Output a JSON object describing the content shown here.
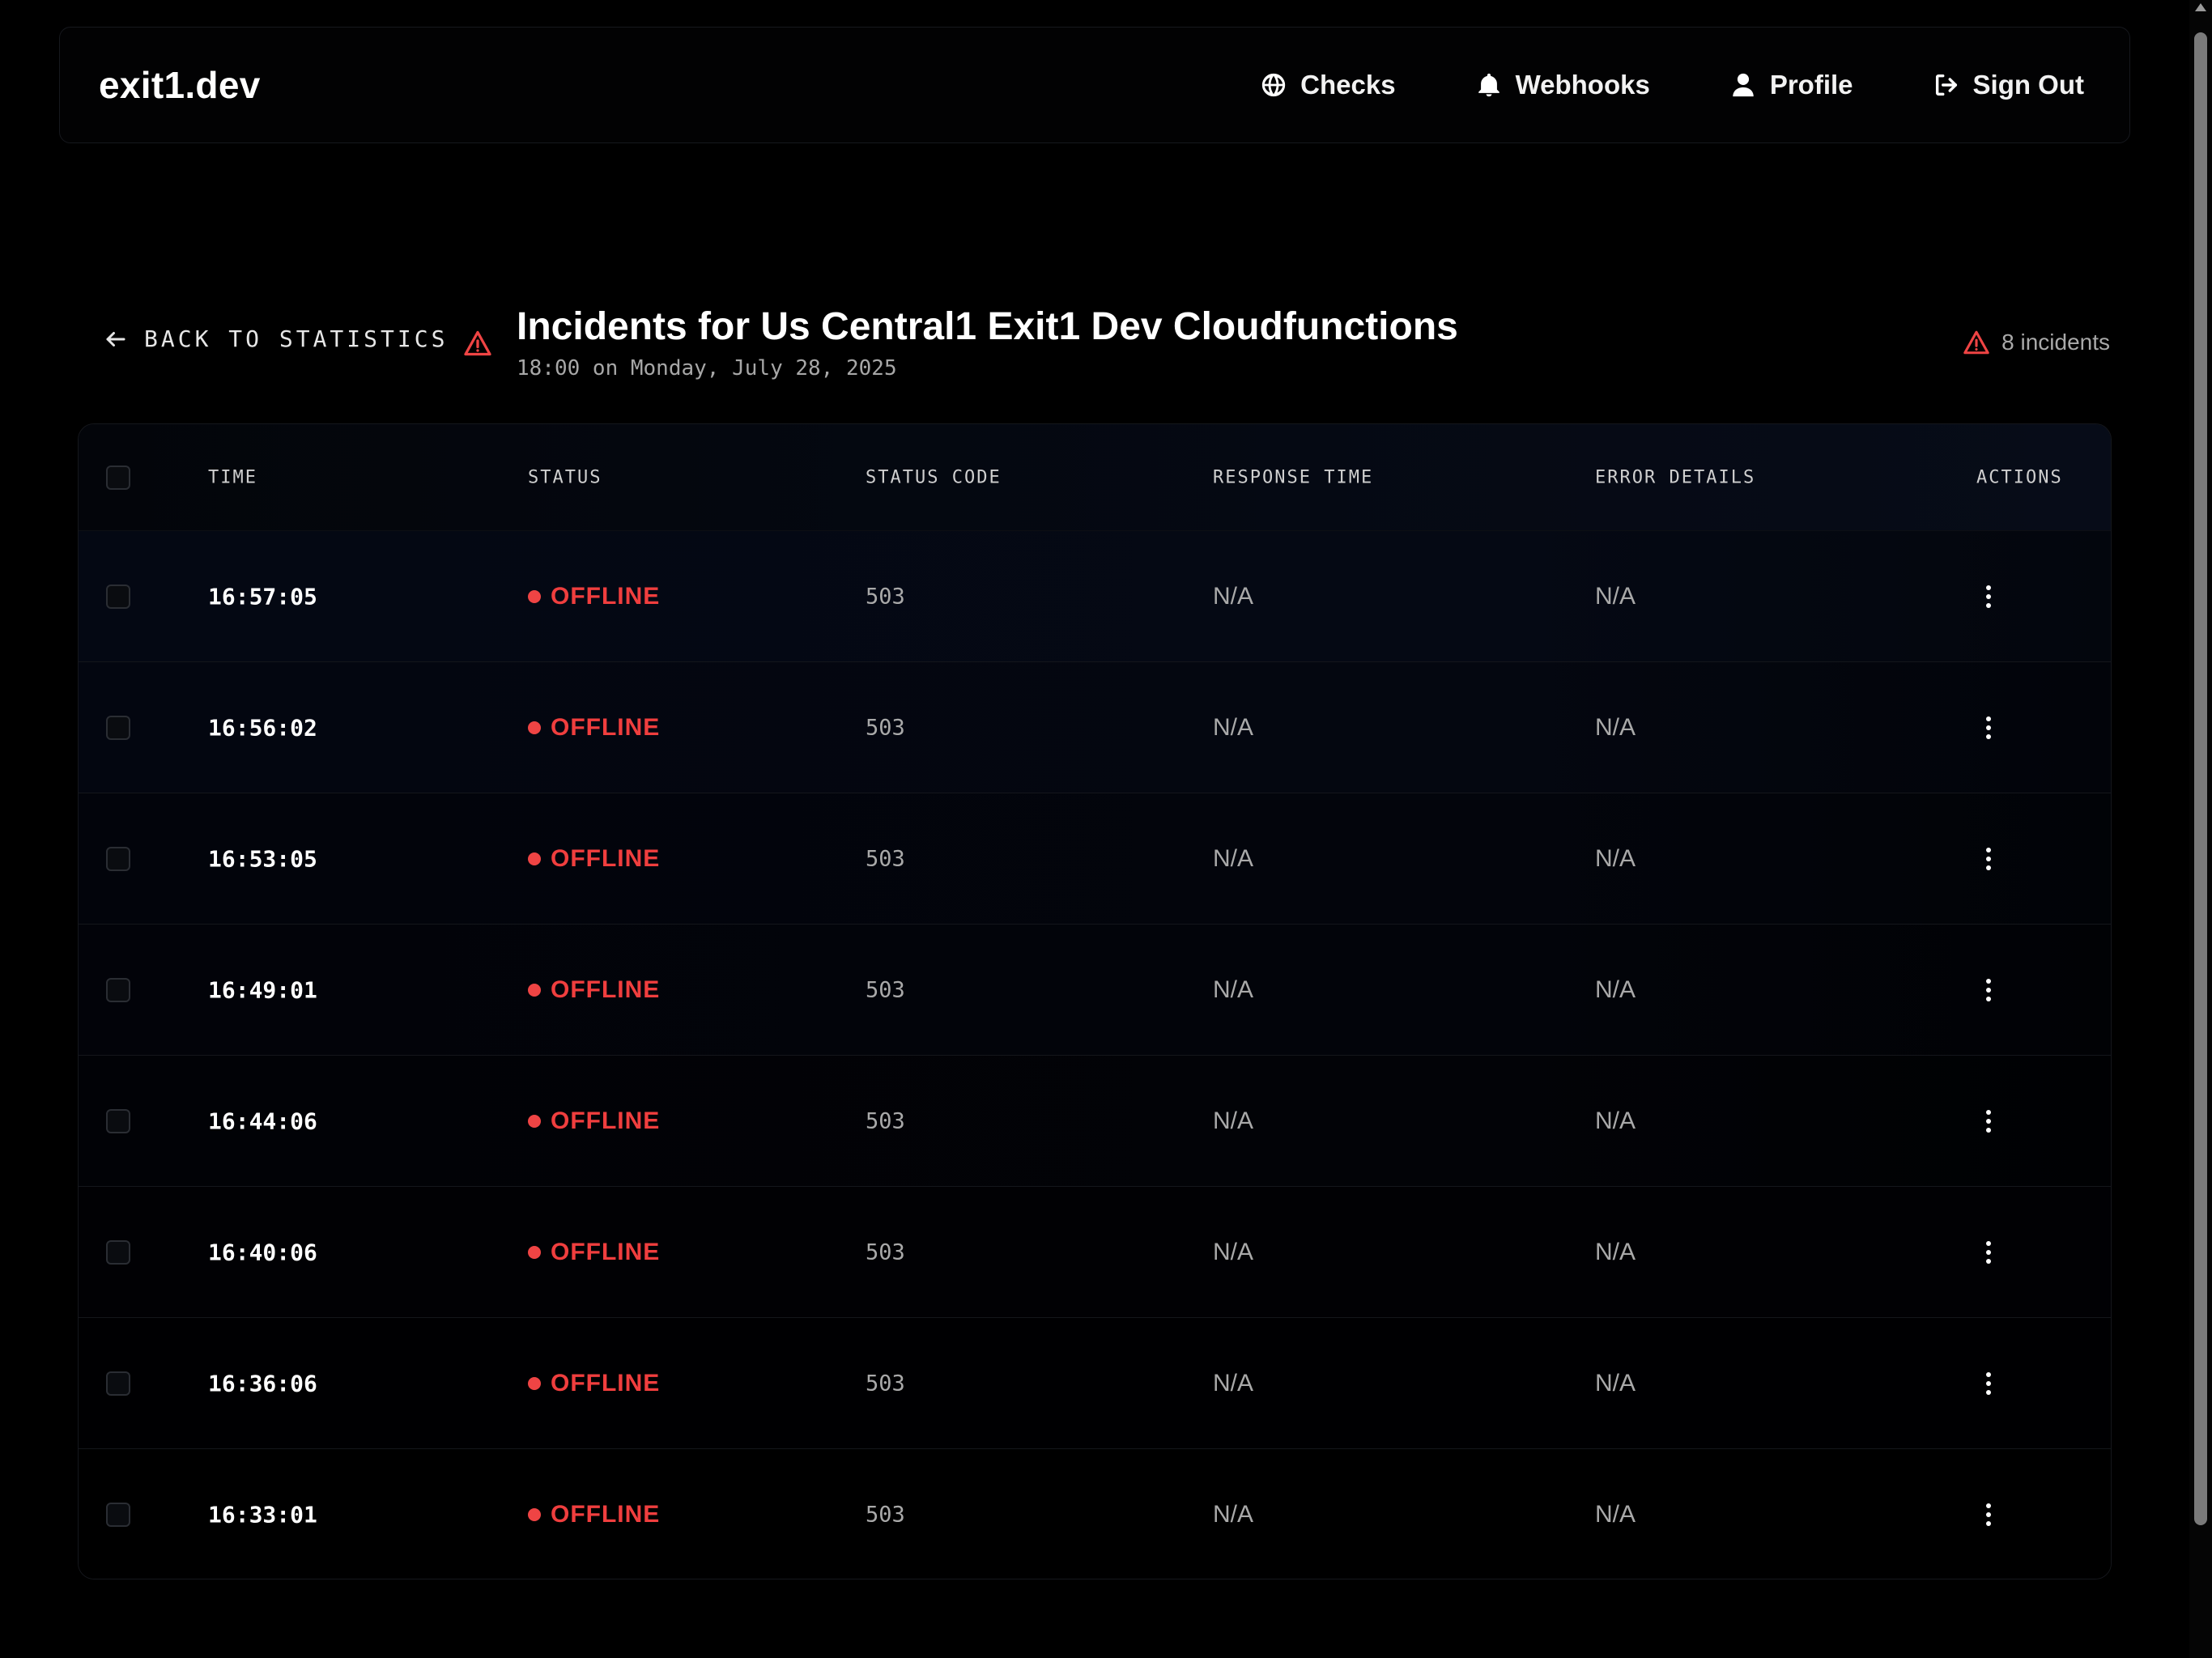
{
  "brand": "exit1.dev",
  "nav": {
    "checks": "Checks",
    "webhooks": "Webhooks",
    "profile": "Profile",
    "sign_out": "Sign Out"
  },
  "back_label": "BACK TO STATISTICS",
  "title": "Incidents for Us Central1 Exit1 Dev Cloudfunctions",
  "subtitle": "18:00 on Monday, July 28, 2025",
  "incident_count": "8 incidents",
  "table": {
    "headers": {
      "time": "TIME",
      "status": "STATUS",
      "status_code": "STATUS CODE",
      "response_time": "RESPONSE TIME",
      "error_details": "ERROR DETAILS",
      "actions": "ACTIONS"
    },
    "rows": [
      {
        "time": "16:57:05",
        "status": "OFFLINE",
        "status_code": "503",
        "response_time": "N/A",
        "error_details": "N/A"
      },
      {
        "time": "16:56:02",
        "status": "OFFLINE",
        "status_code": "503",
        "response_time": "N/A",
        "error_details": "N/A"
      },
      {
        "time": "16:53:05",
        "status": "OFFLINE",
        "status_code": "503",
        "response_time": "N/A",
        "error_details": "N/A"
      },
      {
        "time": "16:49:01",
        "status": "OFFLINE",
        "status_code": "503",
        "response_time": "N/A",
        "error_details": "N/A"
      },
      {
        "time": "16:44:06",
        "status": "OFFLINE",
        "status_code": "503",
        "response_time": "N/A",
        "error_details": "N/A"
      },
      {
        "time": "16:40:06",
        "status": "OFFLINE",
        "status_code": "503",
        "response_time": "N/A",
        "error_details": "N/A"
      },
      {
        "time": "16:36:06",
        "status": "OFFLINE",
        "status_code": "503",
        "response_time": "N/A",
        "error_details": "N/A"
      },
      {
        "time": "16:33:01",
        "status": "OFFLINE",
        "status_code": "503",
        "response_time": "N/A",
        "error_details": "N/A"
      }
    ]
  },
  "icons": {
    "checks": "globe-icon",
    "webhooks": "bell-icon",
    "profile": "user-icon",
    "sign_out": "sign-out-icon",
    "back": "arrow-left-icon",
    "alert": "warning-triangle-icon",
    "row_actions": "more-vertical-icon"
  },
  "colors": {
    "background": "#000000",
    "offline": "#ef4444",
    "alert": "#ef4444",
    "muted_text": "#a9a9a9"
  }
}
